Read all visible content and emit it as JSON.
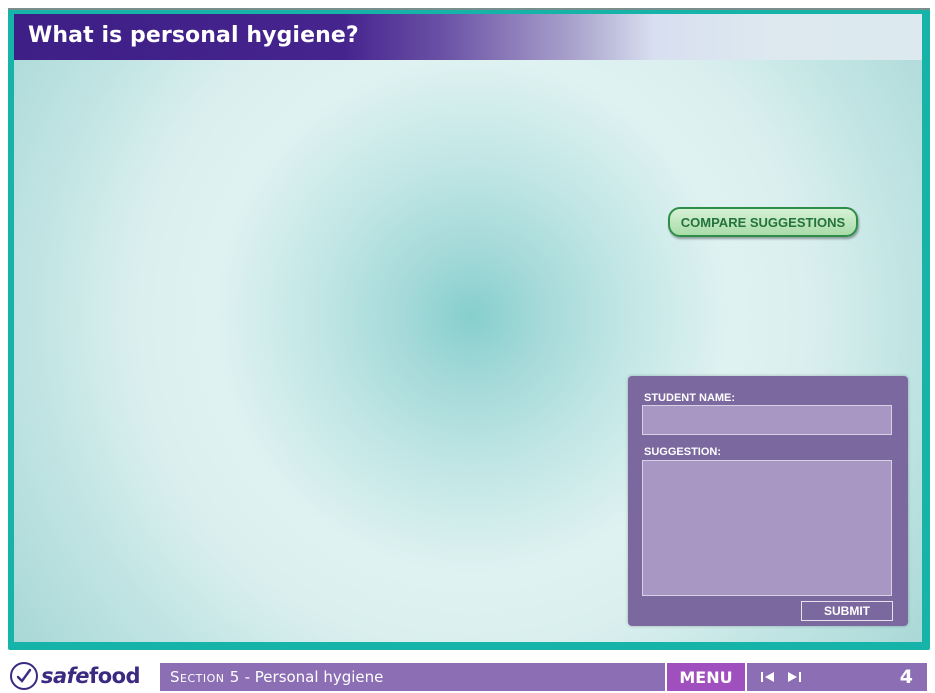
{
  "title": "What is personal hygiene?",
  "compare_button": "COMPARE SUGGESTIONS",
  "form": {
    "student_name_label": "STUDENT NAME:",
    "student_name_value": "",
    "suggestion_label": "SUGGESTION:",
    "suggestion_value": "",
    "submit_label": "SUBMIT"
  },
  "footer": {
    "logo": {
      "safe": "safe",
      "food": "food"
    },
    "section_prefix": "Section 5",
    "section_sep": " - ",
    "section_name": "Personal hygiene",
    "menu_label": "MENU",
    "page_number": "4"
  },
  "icons": [
    "safefood-check-logo",
    "skip-back-icon",
    "skip-forward-icon"
  ],
  "colors": {
    "frame": "#16b3a9",
    "title_bar": "#3d1f86",
    "form_panel": "#7a689f",
    "compare_button_text": "#24733a",
    "footer_bar": "#8b6eb4",
    "menu": "#a04fbe"
  }
}
